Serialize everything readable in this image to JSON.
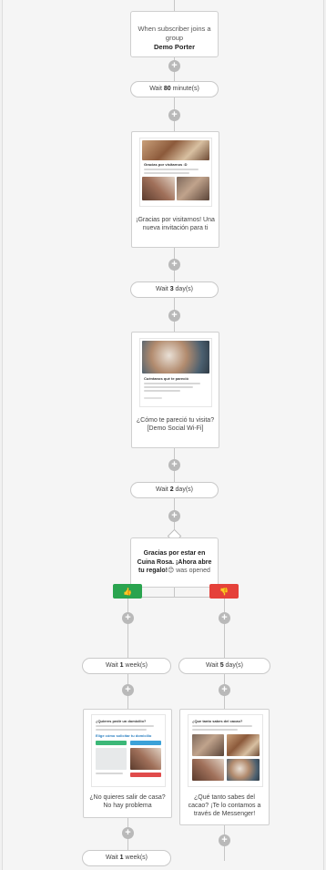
{
  "trigger": {
    "prefix": "When subscriber joins a group",
    "group_name": "Demo Porter"
  },
  "waits": {
    "w1": {
      "prefix": "Wait ",
      "value": "80",
      "suffix": " minute(s)"
    },
    "w2": {
      "prefix": "Wait ",
      "value": "3",
      "suffix": " day(s)"
    },
    "w3": {
      "prefix": "Wait ",
      "value": "2",
      "suffix": " day(s)"
    },
    "w4": {
      "prefix": "Wait ",
      "value": "1",
      "suffix": " week(s)"
    },
    "w5": {
      "prefix": "Wait ",
      "value": "5",
      "suffix": " day(s)"
    },
    "w6": {
      "prefix": "Wait ",
      "value": "1",
      "suffix": " week(s)"
    }
  },
  "emails": {
    "e1": {
      "heading": "Gracias por visitarnos :D",
      "caption": "¡Gracias por visitarnos! Una nueva invitación para ti"
    },
    "e2": {
      "heading": "Cuéntanos qué te pareció",
      "caption": "¿Cómo te pareció tu visita? [Demo Social Wi-Fi]"
    },
    "e3": {
      "heading": "¿Quieres pedir un domicilio?",
      "subheading": "Elige cómo solicitar tu domicilio",
      "caption": "¿No quieres salir de casa? No hay problema"
    },
    "e4": {
      "heading": "¿Que tanto sabes del cacao?",
      "caption": "¿Qué tanto sabes del cacao? ¡Te lo contamos a través de Messenger!"
    }
  },
  "condition": {
    "bold_text": "Gracias por estar en Cuina Rosa. ¡Ahora abre tu regalo!",
    "emoji": "😊",
    "suffix": " was opened"
  },
  "branches": {
    "yes_icon": "thumbs-up-icon",
    "no_icon": "thumbs-down-icon",
    "yes_glyph": "👍",
    "no_glyph": "👎",
    "yes_color": "#2aa44f",
    "no_color": "#e5413a"
  },
  "plus_glyph": "+"
}
